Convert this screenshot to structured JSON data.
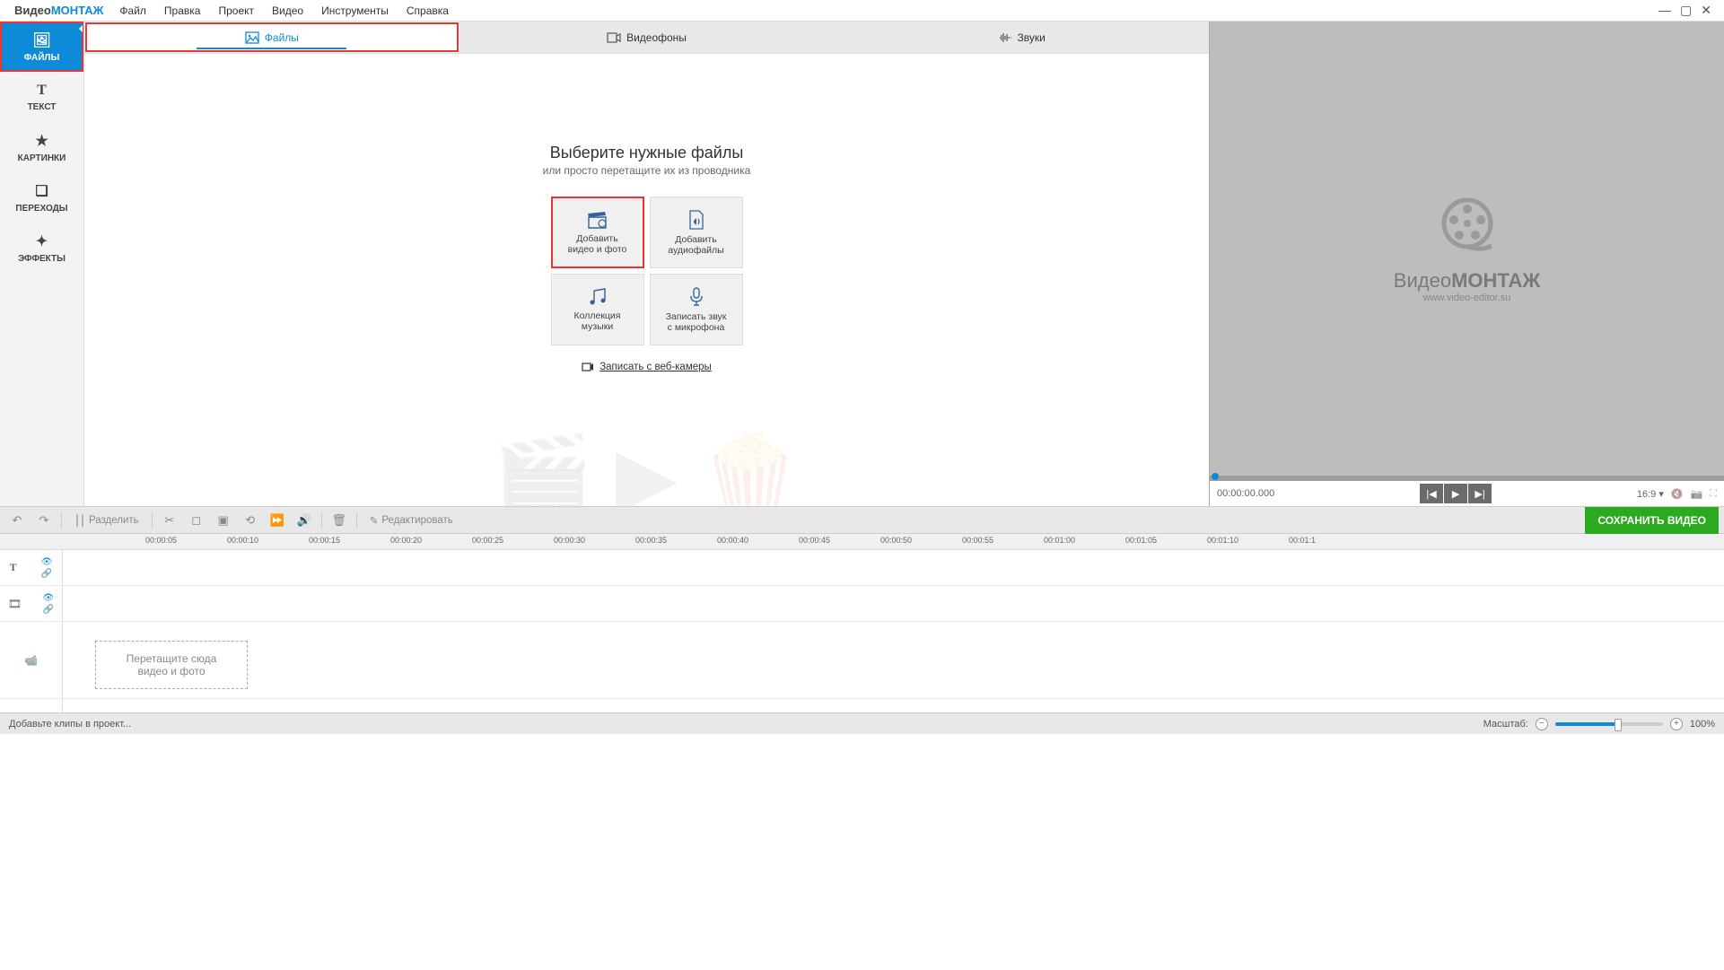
{
  "app": {
    "logo_a": "Видео",
    "logo_b": "МОНТАЖ"
  },
  "menu": [
    "Файл",
    "Правка",
    "Проект",
    "Видео",
    "Инструменты",
    "Справка"
  ],
  "sidebar": [
    {
      "label": "ФАЙЛЫ",
      "icon": "🖼"
    },
    {
      "label": "ТЕКСТ",
      "icon": "T"
    },
    {
      "label": "КАРТИНКИ",
      "icon": "★"
    },
    {
      "label": "ПЕРЕХОДЫ",
      "icon": "❏"
    },
    {
      "label": "ЭФФЕКТЫ",
      "icon": "✦"
    }
  ],
  "top_tabs": [
    {
      "label": "Файлы"
    },
    {
      "label": "Видеофоны"
    },
    {
      "label": "Звуки"
    }
  ],
  "center": {
    "title": "Выберите нужные файлы",
    "subtitle": "или просто перетащите их из проводника",
    "cards": [
      {
        "l1": "Добавить",
        "l2": "видео и фото"
      },
      {
        "l1": "Добавить",
        "l2": "аудиофайлы"
      },
      {
        "l1": "Коллекция",
        "l2": "музыки"
      },
      {
        "l1": "Записать звук",
        "l2": "с микрофона"
      }
    ],
    "webcam": "Записать с веб-камеры"
  },
  "preview": {
    "logo_a": "Видео",
    "logo_b": "МОНТАЖ",
    "url": "www.video-editor.su",
    "time": "00:00:00.000",
    "ratio": "16:9"
  },
  "toolbar": {
    "split": "Разделить",
    "edit": "Редактировать",
    "save": "СОХРАНИТЬ ВИДЕО"
  },
  "timeline": {
    "ticks": [
      "00:00:05",
      "00:00:10",
      "00:00:15",
      "00:00:20",
      "00:00:25",
      "00:00:30",
      "00:00:35",
      "00:00:40",
      "00:00:45",
      "00:00:50",
      "00:00:55",
      "00:01:00",
      "00:01:05",
      "00:01:10",
      "00:01:1"
    ],
    "drop_l1": "Перетащите сюда",
    "drop_l2": "видео и фото"
  },
  "status": {
    "hint": "Добавьте клипы в проект...",
    "zoom_label": "Масштаб:",
    "zoom_value": "100%"
  }
}
